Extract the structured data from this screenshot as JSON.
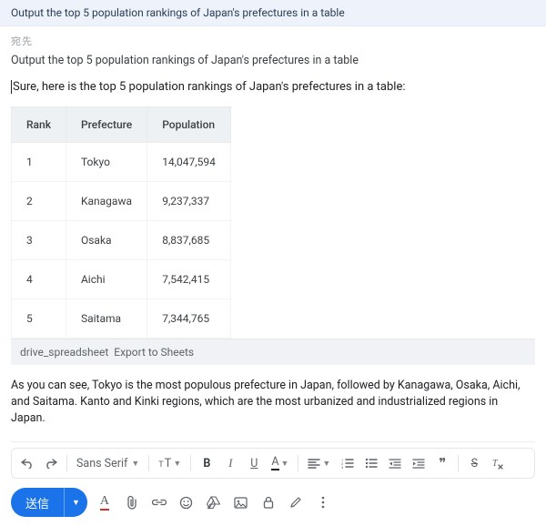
{
  "banner": {
    "text": "Output the top 5 population rankings of Japan's prefectures in a table"
  },
  "head_label": "宛先",
  "prompt_echo": "Output the top 5 population rankings of Japan's prefectures in a table",
  "reply_intro": "Sure, here is the top 5 population rankings of Japan's prefectures in a table:",
  "chart_data": {
    "type": "table",
    "columns": [
      "Rank",
      "Prefecture",
      "Population"
    ],
    "rows": [
      [
        "1",
        "Tokyo",
        "14,047,594"
      ],
      [
        "2",
        "Kanagawa",
        "9,237,337"
      ],
      [
        "3",
        "Osaka",
        "8,837,685"
      ],
      [
        "4",
        "Aichi",
        "7,542,415"
      ],
      [
        "5",
        "Saitama",
        "7,344,765"
      ]
    ]
  },
  "export": {
    "icon_name": "drive_spreadsheet",
    "label": "Export to Sheets"
  },
  "summary": "As you can see, Tokyo is the most populous prefecture in Japan, followed by Kanagawa, Osaka, Aichi, and Saitama. Kanto and Kinki regions, which are the most urbanized and industrialized regions in Japan.",
  "toolbar": {
    "font_family": "Sans Serif",
    "bold": "B",
    "italic": "I",
    "underline": "U",
    "text_color": "A",
    "align_left": "≡",
    "list_bulleted": "•≡",
    "list_numbered": "1≡",
    "indent_decrease": "⇤",
    "indent_increase": "⇥",
    "quote": "❞",
    "strike": "S",
    "clear_format": "✗"
  },
  "send": {
    "label": "送信"
  }
}
